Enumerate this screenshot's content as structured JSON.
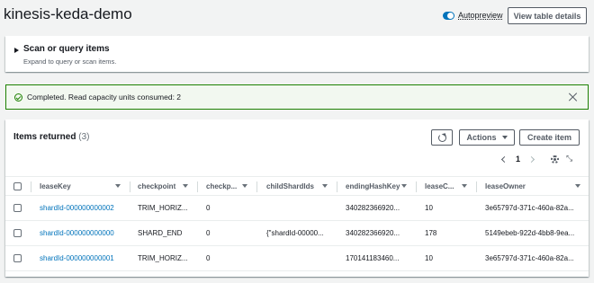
{
  "header": {
    "title": "kinesis-keda-demo",
    "autopreview_label": "Autopreview",
    "view_table_label": "View table details"
  },
  "scan": {
    "title": "Scan or query items",
    "subtitle": "Expand to query or scan items."
  },
  "alert": {
    "message": "Completed. Read capacity units consumed: 2"
  },
  "items": {
    "title": "Items returned",
    "count": "(3)",
    "actions_label": "Actions",
    "create_label": "Create item",
    "page": "1",
    "columns": [
      "leaseKey",
      "checkpoint",
      "checkp...",
      "childShardIds",
      "endingHashKey",
      "leaseC...",
      "leaseOwner"
    ],
    "rows": [
      {
        "leaseKey": "shardId-000000000002",
        "checkpoint": "TRIM_HORIZ...",
        "checkp": "0",
        "childShardIds": "",
        "endingHashKey": "340282366920...",
        "leaseC": "10",
        "leaseOwner": "3e65797d-371c-460a-82a..."
      },
      {
        "leaseKey": "shardId-000000000000",
        "checkpoint": "SHARD_END",
        "checkp": "0",
        "childShardIds": "{\"shardId-00000...",
        "endingHashKey": "340282366920...",
        "leaseC": "178",
        "leaseOwner": "5149ebeb-922d-4bb8-9ea..."
      },
      {
        "leaseKey": "shardId-000000000001",
        "checkpoint": "TRIM_HORIZ...",
        "checkp": "0",
        "childShardIds": "",
        "endingHashKey": "170141183460...",
        "leaseC": "10",
        "leaseOwner": "3e65797d-371c-460a-82a..."
      }
    ]
  },
  "icons": {
    "toggle": "toggle-icon",
    "expand": "caret-right-icon",
    "success": "check-circle-icon",
    "dismiss": "close-icon",
    "refresh": "refresh-icon",
    "settings": "gear-icon",
    "collapse": "collapse-icon"
  },
  "colors": {
    "accent": "#0073bb",
    "success": "#1d8102",
    "success_bg": "#f2f8f0"
  }
}
